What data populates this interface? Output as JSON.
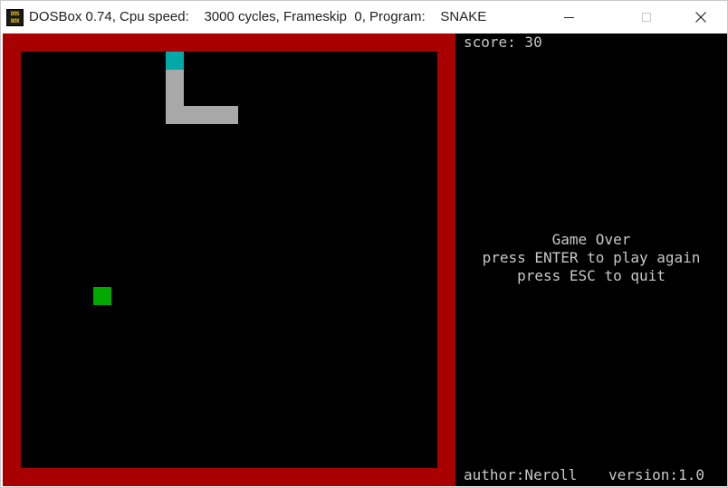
{
  "window": {
    "title_app": "DOSBox 0.74, Cpu speed:",
    "title_cycles": "3000 cycles, Frameskip  0, Program:",
    "title_program": "SNAKE",
    "icon_text_top": "DOS",
    "icon_text_bottom": "BOX",
    "close_glyph": "✕"
  },
  "game": {
    "score_text": "score: 30",
    "message_title": "Game Over",
    "message_enter": "press ENTER to play again",
    "message_esc": "press ESC to quit",
    "author_text": "author:Neroll",
    "version_text": "version:1.0"
  },
  "colors": {
    "border": "#a80000",
    "snake_head": "#00a8a8",
    "snake_body": "#a8a8a8",
    "food": "#00a800",
    "text": "#c8c8c8"
  }
}
